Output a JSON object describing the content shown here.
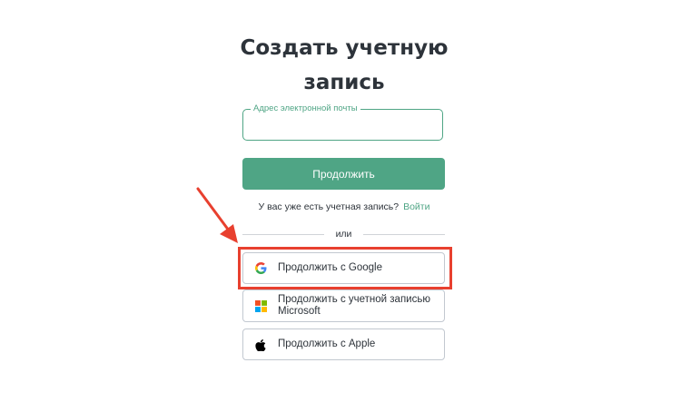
{
  "page": {
    "title": "Создать учетную запись"
  },
  "email_field": {
    "label": "Адрес электронной почты",
    "value": ""
  },
  "continue_button": {
    "label": "Продолжить"
  },
  "login": {
    "prompt": "У вас уже есть учетная запись?",
    "link": "Войти"
  },
  "divider": {
    "text": "или"
  },
  "social": {
    "google": "Продолжить с Google",
    "microsoft": "Продолжить с учетной записью Microsoft",
    "apple": "Продолжить с Apple"
  },
  "colors": {
    "accent": "#4fa585",
    "highlight": "#e8402f"
  },
  "annotation": {
    "highlighted_element": "google-continue-button"
  }
}
